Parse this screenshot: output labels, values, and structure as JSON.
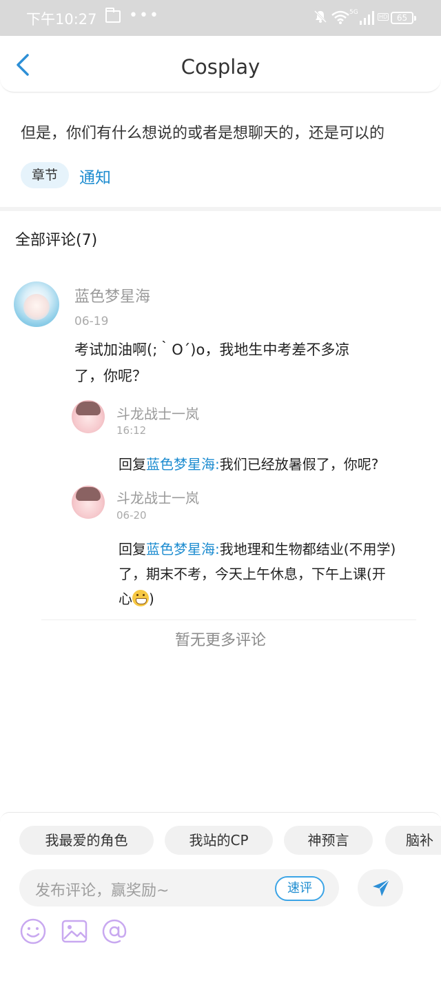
{
  "status_bar": {
    "time": "下午10:27",
    "network": "5G",
    "hd": "HD",
    "battery": "65"
  },
  "header": {
    "title": "Cosplay"
  },
  "content": {
    "text": "但是，你们有什么想说的或者是想聊天的，还是可以的",
    "tag_chapter": "章节",
    "tag_notice": "通知"
  },
  "comments": {
    "title": "全部评论(7)",
    "main": {
      "author": "蓝色梦星海",
      "date": "06-19",
      "body_line1": "考试加油啊(;｀O´)o，我地生中考差不多凉",
      "body_line2": "了，你呢？"
    },
    "replies": [
      {
        "author": "斗龙战士一岚",
        "time": "16:12",
        "prefix": "回复",
        "mention": "蓝色梦星海:",
        "text": "我们已经放暑假了，你呢?"
      },
      {
        "author": "斗龙战士一岚",
        "time": "06-20",
        "prefix": "回复",
        "mention": "蓝色梦星海:",
        "text_line1": "我地理和生物都结业(不用学)",
        "text_line2": "了，期末不考，今天上午休息，下午上课(开",
        "text_line3_start": "心",
        "text_line3_end": ")"
      }
    ],
    "no_more": "暂无更多评论"
  },
  "bottom": {
    "chips": [
      "我最爱的角色",
      "我站的CP",
      "神预言",
      "脑补"
    ],
    "input_placeholder": "发布评论，赢奖励~",
    "quick_review": "速评"
  },
  "colors": {
    "accent": "#1d8cd0",
    "tool_icon": "#c8a8f0",
    "status_bar": "#d9d9d9"
  },
  "icons": [
    "back-arrow-icon",
    "folder-icon",
    "more-dots-icon",
    "mute-bell-icon",
    "wifi-icon",
    "signal-icon",
    "battery-icon",
    "send-icon",
    "emoji-icon",
    "image-icon",
    "at-icon"
  ]
}
